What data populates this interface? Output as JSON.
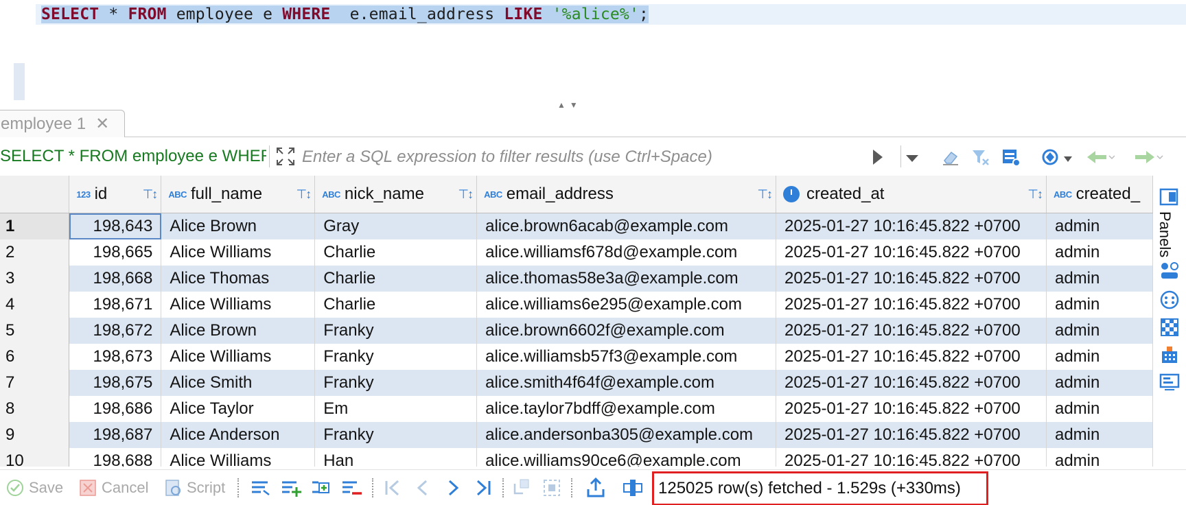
{
  "editor": {
    "sql_keyword_select": "SELECT",
    "sql_star": " * ",
    "sql_keyword_from": "FROM",
    "sql_table": " employee e ",
    "sql_keyword_where": "WHERE",
    "sql_column": "  e.email_address ",
    "sql_keyword_like": "LIKE",
    "sql_string": " '%alice%'",
    "sql_terminator": ";"
  },
  "result_tab": {
    "label": "employee 1"
  },
  "filter_bar": {
    "query_label": "SELECT * FROM employee e WHERE  e.email_address LIKE '%alice%'",
    "placeholder": "Enter a SQL expression to filter results (use Ctrl+Space)"
  },
  "grid": {
    "columns": [
      {
        "name": "id",
        "type_badge": "123"
      },
      {
        "name": "full_name",
        "type_badge": "ABC"
      },
      {
        "name": "nick_name",
        "type_badge": "ABC"
      },
      {
        "name": "email_address",
        "type_badge": "ABC"
      },
      {
        "name": "created_at",
        "type_badge": "clock"
      },
      {
        "name": "created_",
        "type_badge": "ABC"
      }
    ],
    "rows": [
      {
        "n": "1",
        "id": "198,643",
        "full_name": "Alice Brown",
        "nick_name": "Gray",
        "email": "alice.brown6acab@example.com",
        "created_at": "2025-01-27 10:16:45.822 +0700",
        "created_by": "admin"
      },
      {
        "n": "2",
        "id": "198,665",
        "full_name": "Alice Williams",
        "nick_name": "Charlie",
        "email": "alice.williamsf678d@example.com",
        "created_at": "2025-01-27 10:16:45.822 +0700",
        "created_by": "admin"
      },
      {
        "n": "3",
        "id": "198,668",
        "full_name": "Alice Thomas",
        "nick_name": "Charlie",
        "email": "alice.thomas58e3a@example.com",
        "created_at": "2025-01-27 10:16:45.822 +0700",
        "created_by": "admin"
      },
      {
        "n": "4",
        "id": "198,671",
        "full_name": "Alice Williams",
        "nick_name": "Charlie",
        "email": "alice.williams6e295@example.com",
        "created_at": "2025-01-27 10:16:45.822 +0700",
        "created_by": "admin"
      },
      {
        "n": "5",
        "id": "198,672",
        "full_name": "Alice Brown",
        "nick_name": "Franky",
        "email": "alice.brown6602f@example.com",
        "created_at": "2025-01-27 10:16:45.822 +0700",
        "created_by": "admin"
      },
      {
        "n": "6",
        "id": "198,673",
        "full_name": "Alice Williams",
        "nick_name": "Franky",
        "email": "alice.williamsb57f3@example.com",
        "created_at": "2025-01-27 10:16:45.822 +0700",
        "created_by": "admin"
      },
      {
        "n": "7",
        "id": "198,675",
        "full_name": "Alice Smith",
        "nick_name": "Franky",
        "email": "alice.smith4f64f@example.com",
        "created_at": "2025-01-27 10:16:45.822 +0700",
        "created_by": "admin"
      },
      {
        "n": "8",
        "id": "198,686",
        "full_name": "Alice Taylor",
        "nick_name": "Em",
        "email": "alice.taylor7bdff@example.com",
        "created_at": "2025-01-27 10:16:45.822 +0700",
        "created_by": "admin"
      },
      {
        "n": "9",
        "id": "198,687",
        "full_name": "Alice Anderson",
        "nick_name": "Franky",
        "email": "alice.andersonba305@example.com",
        "created_at": "2025-01-27 10:16:45.822 +0700",
        "created_by": "admin"
      },
      {
        "n": "10",
        "id": "198,688",
        "full_name": "Alice Williams",
        "nick_name": "Han",
        "email": "alice.williams90ce6@example.com",
        "created_at": "2025-01-27 10:16:45.822 +0700",
        "created_by": "admin"
      }
    ]
  },
  "side_rail": {
    "panels_label": "Panels"
  },
  "bottom_toolbar": {
    "save_label": "Save",
    "cancel_label": "Cancel",
    "script_label": "Script",
    "status_text": "125025 row(s) fetched - 1.529s (+330ms)"
  },
  "colors": {
    "keyword": "#7f0a2b",
    "string": "#2a8a1f",
    "row_alt": "#dce6f2",
    "accent": "#2f7fd8",
    "status_highlight": "#e02020"
  }
}
